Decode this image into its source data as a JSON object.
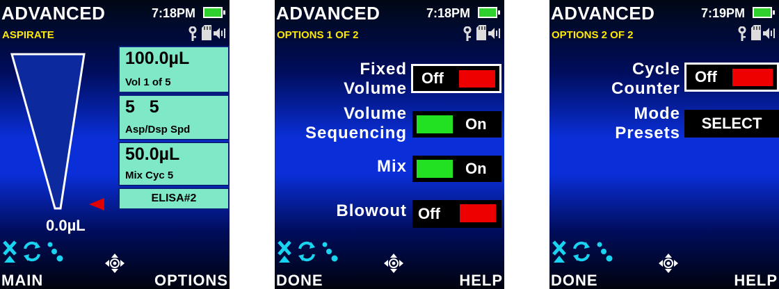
{
  "screens": [
    {
      "title": "ADVANCED",
      "subtitle": "ASPIRATE",
      "time": "7:18PM",
      "volume_readout": "0.0µL",
      "tiles": [
        {
          "main": "100.0µL",
          "sub": "Vol 1 of 5"
        },
        {
          "main": "5   5",
          "sub": "Asp/Dsp Spd"
        },
        {
          "main": "50.0µL",
          "sub": "Mix Cyc 5"
        },
        {
          "label": "ELISA#2"
        }
      ],
      "softkey_left": "MAIN",
      "softkey_right": "OPTIONS"
    },
    {
      "title": "ADVANCED",
      "subtitle": "OPTIONS 1 OF 2",
      "time": "7:18PM",
      "options": [
        {
          "label_line1": "Fixed",
          "label_line2": "Volume",
          "value": "Off"
        },
        {
          "label_line1": "Volume",
          "label_line2": "Sequencing",
          "value": "On"
        },
        {
          "label_line1": "Mix",
          "value": "On"
        },
        {
          "label_line1": "Blowout",
          "value": "Off"
        }
      ],
      "softkey_left": "DONE",
      "softkey_right": "HELP"
    },
    {
      "title": "ADVANCED",
      "subtitle": "OPTIONS 2 OF 2",
      "time": "7:19PM",
      "options": [
        {
          "label_line1": "Cycle",
          "label_line2": "Counter",
          "value": "Off"
        },
        {
          "label_line1": "Mode",
          "label_line2": "Presets",
          "value": "SELECT"
        }
      ],
      "softkey_left": "DONE",
      "softkey_right": "HELP"
    }
  ],
  "colors": {
    "screen_blue": "#0a2fd9",
    "subtitle_yellow": "#ffe800",
    "tile_mint": "#7fe8c7",
    "toggle_on_green": "#22e022",
    "toggle_off_red": "#ee0000",
    "battery_green": "#2fd12f",
    "status_icon_cyan": "#19d4f0",
    "pointer_red": "#e00000"
  },
  "icons": [
    "battery-icon",
    "key-icon",
    "memory-card-icon",
    "speaker-icon",
    "tip-eject-icon",
    "cycle-icon",
    "droplets-icon",
    "navigation-pad-icon"
  ]
}
